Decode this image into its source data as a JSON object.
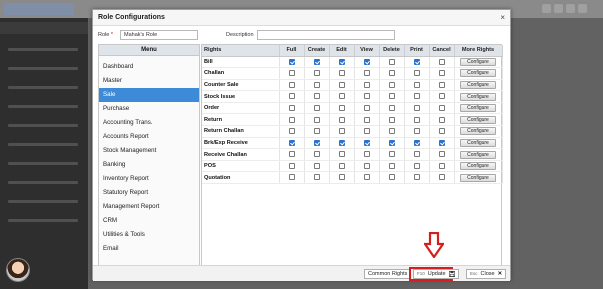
{
  "modal": {
    "title": "Role Configurations",
    "close_glyph": "×",
    "role_label": "Role",
    "role_required_mark": "*",
    "role_value": "Mahak's Role",
    "description_label": "Description",
    "description_value": ""
  },
  "menu": {
    "header": "Menu",
    "items": [
      "Dashboard",
      "Master",
      "Sale",
      "Purchase",
      "Accounting Trans.",
      "Accounts Report",
      "Stock Management",
      "Banking",
      "Inventory Report",
      "Statutory Report",
      "Management Report",
      "CRM",
      "Utilities & Tools",
      "Email"
    ],
    "active": "Sale"
  },
  "rights": {
    "columns": [
      "Rights",
      "Full",
      "Create",
      "Edit",
      "View",
      "Delete",
      "Print",
      "Cancel",
      "More Rights"
    ],
    "configure_label": "Configure",
    "rows": [
      {
        "name": "Bill",
        "checks": [
          true,
          true,
          true,
          true,
          false,
          true,
          false
        ]
      },
      {
        "name": "Challan",
        "checks": [
          false,
          false,
          false,
          false,
          false,
          false,
          false
        ]
      },
      {
        "name": "Counter Sale",
        "checks": [
          false,
          false,
          false,
          false,
          false,
          false,
          false
        ]
      },
      {
        "name": "Stock Issue",
        "checks": [
          false,
          false,
          false,
          false,
          false,
          false,
          false
        ]
      },
      {
        "name": "Order",
        "checks": [
          false,
          false,
          false,
          false,
          false,
          false,
          false
        ]
      },
      {
        "name": "Return",
        "checks": [
          false,
          false,
          false,
          false,
          false,
          false,
          false
        ]
      },
      {
        "name": "Return Challan",
        "checks": [
          false,
          false,
          false,
          false,
          false,
          false,
          false
        ]
      },
      {
        "name": "Brk/Exp Receive",
        "checks": [
          true,
          true,
          true,
          true,
          true,
          true,
          true
        ]
      },
      {
        "name": "Receive Challan",
        "checks": [
          false,
          false,
          false,
          false,
          false,
          false,
          false
        ]
      },
      {
        "name": "POS",
        "checks": [
          false,
          false,
          false,
          false,
          false,
          false,
          false
        ]
      },
      {
        "name": "Quotation",
        "checks": [
          false,
          false,
          false,
          false,
          false,
          false,
          false
        ]
      }
    ]
  },
  "footer": {
    "common_rights_label": "Common Rights",
    "update_key": "F10",
    "update_label": "Update",
    "close_key": "Esc",
    "close_label": "Close",
    "close_glyph": "✕"
  },
  "colors": {
    "active_menu": "#3d8bd8",
    "checkbox_checked": "#2a72d0",
    "highlight_border": "#d31f1f",
    "arrow": "#d31f1f"
  },
  "icons": [
    "save-icon",
    "close-icon",
    "down-arrow-annotation-icon"
  ]
}
